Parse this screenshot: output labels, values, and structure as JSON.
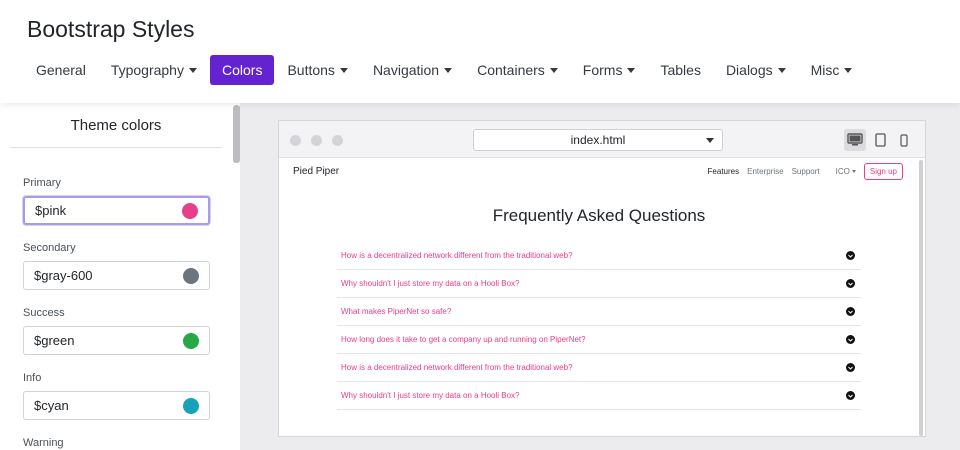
{
  "app": {
    "title": "Bootstrap Styles"
  },
  "nav": {
    "items": [
      {
        "label": "General",
        "dropdown": false,
        "active": false
      },
      {
        "label": "Typography",
        "dropdown": true,
        "active": false
      },
      {
        "label": "Colors",
        "dropdown": false,
        "active": true
      },
      {
        "label": "Buttons",
        "dropdown": true,
        "active": false
      },
      {
        "label": "Navigation",
        "dropdown": true,
        "active": false
      },
      {
        "label": "Containers",
        "dropdown": true,
        "active": false
      },
      {
        "label": "Forms",
        "dropdown": true,
        "active": false
      },
      {
        "label": "Tables",
        "dropdown": false,
        "active": false
      },
      {
        "label": "Dialogs",
        "dropdown": true,
        "active": false
      },
      {
        "label": "Misc",
        "dropdown": true,
        "active": false
      }
    ]
  },
  "sidebar": {
    "title": "Theme colors",
    "fields": [
      {
        "label": "Primary",
        "value": "$pink",
        "color": "#e83e8c"
      },
      {
        "label": "Secondary",
        "value": "$gray-600",
        "color": "#6c757d"
      },
      {
        "label": "Success",
        "value": "$green",
        "color": "#28a745"
      },
      {
        "label": "Info",
        "value": "$cyan",
        "color": "#17a2b8"
      },
      {
        "label": "Warning"
      }
    ]
  },
  "preview": {
    "file_select": "index.html",
    "devices": [
      "desktop-icon",
      "tablet-icon",
      "phone-icon"
    ],
    "site": {
      "brand": "Pied Piper",
      "nav": [
        "Features",
        "Enterprise",
        "Support",
        "ICO"
      ],
      "signup": "Sign up",
      "heading": "Frequently Asked Questions",
      "questions": [
        "How is a decentralized network different from the traditional web?",
        "Why shouldn't I just store my data on a Hooli Box?",
        "What makes PiperNet so safe?",
        "How long does it take to get a company up and running on PiperNet?",
        "How is a decentralized network different from the traditional web?",
        "Why shouldn't I just store my data on a Hooli Box?"
      ]
    }
  },
  "colors": {
    "accent": "#6323d1",
    "pink": "#e83e8c"
  }
}
